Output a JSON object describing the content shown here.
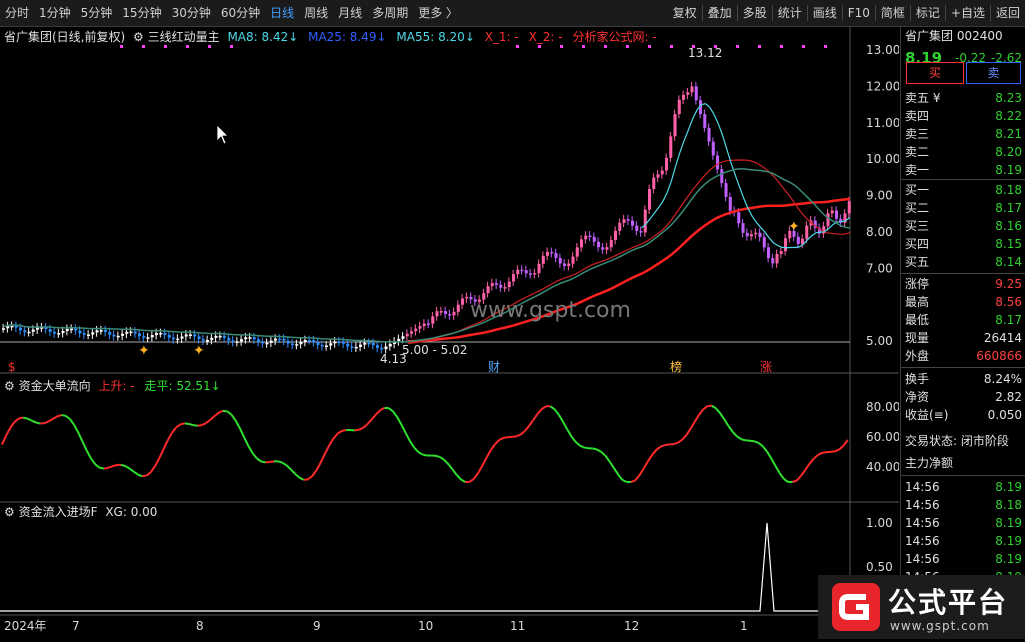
{
  "toolbar": {
    "periods": [
      "分时",
      "1分钟",
      "5分钟",
      "15分钟",
      "30分钟",
      "60分钟",
      "日线",
      "周线",
      "月线",
      "多周期",
      "更多 〉"
    ],
    "active": "日线",
    "tools": [
      "复权",
      "叠加",
      "多股",
      "统计",
      "画线",
      "F10",
      "简框",
      "标记",
      "+自选",
      "返回"
    ]
  },
  "main_panel": {
    "title": "省广集团(日线,前复权)",
    "indicator": "三线红动量主",
    "ma8": "MA8: 8.42↓",
    "ma25": "MA25: 8.49↓",
    "ma55": "MA55: 8.20↓",
    "x1": "X_1: -",
    "x2": "X_2: -",
    "note": "分析家公式网: -",
    "high_label": "13.12",
    "low_label": "4.13",
    "level_label": "5.00 - 5.02",
    "events": [
      "$",
      "财",
      "榜",
      "涨"
    ]
  },
  "sub1": {
    "title": "资金大单流向",
    "up": "上升: -",
    "flat": "走平: 52.51↓"
  },
  "sub2": {
    "title": "资金流入进场F",
    "xg": "XG: 0.00"
  },
  "y_main": [
    "13.00",
    "12.00",
    "11.00",
    "10.00",
    "9.00",
    "8.00",
    "7.00",
    "5.00"
  ],
  "y_sub1": [
    "80.00",
    "60.00",
    "40.00"
  ],
  "y_sub2": [
    "1.00",
    "0.50"
  ],
  "x_axis": [
    "2024年",
    "7",
    "8",
    "9",
    "10",
    "11",
    "12",
    "1"
  ],
  "watermark": "www.gspt.com",
  "right": {
    "stock_name": "省广集团 002400",
    "price": "8.19",
    "change": "-0.22",
    "pct": "-2.62",
    "buy": "买",
    "sell": "卖",
    "asks": [
      {
        "l": "卖五 ¥",
        "p": "8.23"
      },
      {
        "l": "卖四",
        "p": "8.22"
      },
      {
        "l": "卖三",
        "p": "8.21"
      },
      {
        "l": "卖二",
        "p": "8.20"
      },
      {
        "l": "卖一",
        "p": "8.19"
      }
    ],
    "bids": [
      {
        "l": "买一",
        "p": "8.18"
      },
      {
        "l": "买二",
        "p": "8.17"
      },
      {
        "l": "买三",
        "p": "8.16"
      },
      {
        "l": "买四",
        "p": "8.15"
      },
      {
        "l": "买五",
        "p": "8.14"
      }
    ],
    "stats": [
      {
        "l": "涨停",
        "v": "9.25"
      },
      {
        "l": "最高",
        "v": "8.56"
      },
      {
        "l": "最低",
        "v": "8.17"
      },
      {
        "l": "现量",
        "v": "26414"
      },
      {
        "l": "外盘",
        "v": "660866"
      }
    ],
    "stats2": [
      {
        "l": "换手",
        "v": "8.24%"
      },
      {
        "l": "净资",
        "v": "2.82"
      },
      {
        "l": "收益(≡)",
        "v": "0.050"
      }
    ],
    "trade_state": "交易状态: 闭市阶段",
    "net_title": "主力净额",
    "ticks": [
      {
        "t": "14:56",
        "v": "8.19"
      },
      {
        "t": "14:56",
        "v": "8.18"
      },
      {
        "t": "14:56",
        "v": "8.19"
      },
      {
        "t": "14:56",
        "v": "8.19"
      },
      {
        "t": "14:56",
        "v": "8.19"
      },
      {
        "t": "14:56",
        "v": "8.19"
      }
    ]
  },
  "brand": {
    "name": "公式平台",
    "url": "www.gspt.com"
  }
}
